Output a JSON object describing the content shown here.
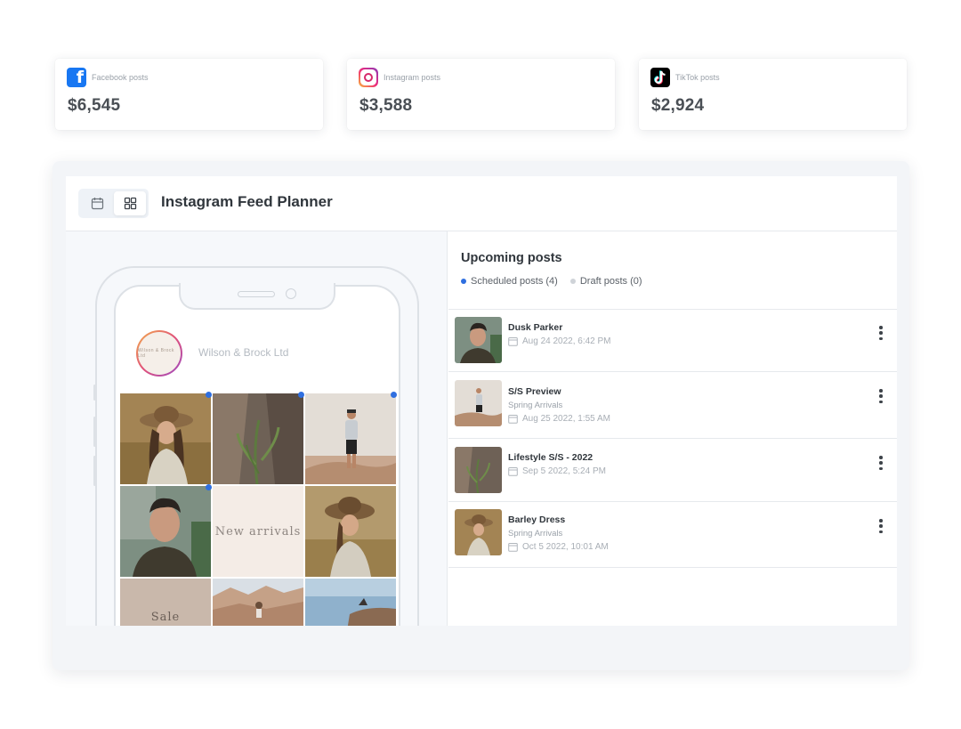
{
  "stats": [
    {
      "platform": "facebook",
      "icon": "facebook-icon",
      "label": "Facebook posts",
      "value": "$6,545"
    },
    {
      "platform": "instagram",
      "icon": "instagram-icon",
      "label": "Instagram posts",
      "value": "$3,588"
    },
    {
      "platform": "tiktok",
      "icon": "tiktok-icon",
      "label": "TikTok posts",
      "value": "$2,924"
    }
  ],
  "planner": {
    "title": "Instagram Feed Planner",
    "active_view": "grid",
    "profile": {
      "name": "Wilson & Brock Ltd",
      "avatar_text": "Wilson & Brock Ltd"
    },
    "feed_tiles": [
      {
        "kind": "photo",
        "subject": "woman in hat",
        "scheduled": true
      },
      {
        "kind": "photo",
        "subject": "rock plants",
        "scheduled": true
      },
      {
        "kind": "photo",
        "subject": "man standing desert",
        "scheduled": true
      },
      {
        "kind": "photo",
        "subject": "man portrait",
        "scheduled": true
      },
      {
        "kind": "text",
        "text": "New arrivals"
      },
      {
        "kind": "photo",
        "subject": "woman in hat field"
      },
      {
        "kind": "text",
        "text": "Sale"
      },
      {
        "kind": "photo",
        "subject": "canyon"
      },
      {
        "kind": "photo",
        "subject": "lake cliff"
      }
    ]
  },
  "upcoming": {
    "title": "Upcoming posts",
    "filters": [
      {
        "label": "Scheduled posts (4)",
        "color": "#2f6fe0"
      },
      {
        "label": "Draft posts (0)",
        "color": "#cfd3d8"
      }
    ],
    "posts": [
      {
        "title": "Dusk Parker",
        "subtitle": "",
        "date": "Aug 24 2022, 6:42 PM"
      },
      {
        "title": "S/S Preview",
        "subtitle": "Spring Arrivals",
        "date": "Aug 25 2022, 1:55 AM"
      },
      {
        "title": "Lifestyle S/S - 2022",
        "subtitle": "",
        "date": "Sep 5 2022, 5:24 PM"
      },
      {
        "title": "Barley Dress",
        "subtitle": "Spring Arrivals",
        "date": "Oct 5 2022, 10:01 AM"
      }
    ]
  },
  "colors": {
    "accent": "#2f6fe0",
    "facebook": "#1877f2",
    "tiktok": "#000000"
  }
}
